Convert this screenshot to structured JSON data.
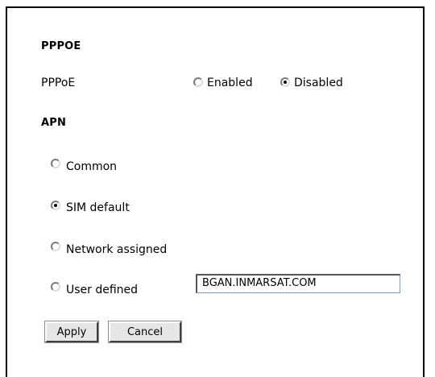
{
  "pppoe_section": {
    "heading": "PPPOE",
    "field_label": "PPPoE",
    "options": [
      {
        "label": "Enabled",
        "selected": false
      },
      {
        "label": "Disabled",
        "selected": true
      }
    ]
  },
  "apn_section": {
    "heading": "APN",
    "options": [
      {
        "label": "Common",
        "selected": false
      },
      {
        "label": "SIM default",
        "selected": true
      },
      {
        "label": "Network assigned",
        "selected": false
      },
      {
        "label": "User defined",
        "selected": false
      }
    ],
    "user_defined_value": "BGAN.INMARSAT.COM"
  },
  "buttons": {
    "apply": "Apply",
    "cancel": "Cancel"
  }
}
